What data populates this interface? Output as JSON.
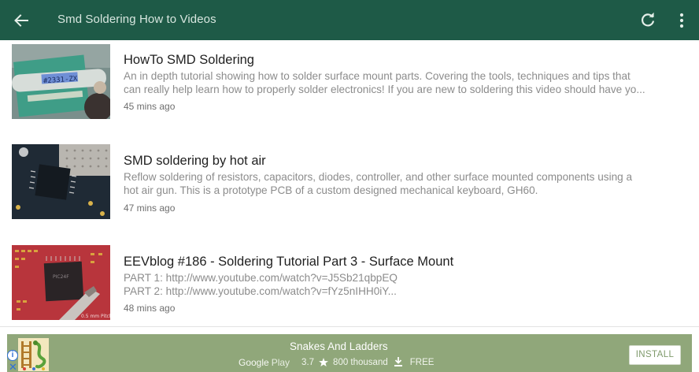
{
  "appbar": {
    "title": "Smd Soldering How to Videos",
    "back_icon": "arrow-left-icon",
    "refresh_icon": "refresh-icon",
    "more_icon": "more-vert-icon"
  },
  "videos": [
    {
      "title": "HowTo SMD Soldering",
      "description_lines": [
        "An in depth tutorial showing how to solder surface mount parts. Covering the tools, techniques and tips that",
        "can really help learn how to properly solder electronics! If you are new to soldering this video should have yo..."
      ],
      "time": "45 mins ago"
    },
    {
      "title": "SMD soldering by hot air",
      "description_lines": [
        "Reflow soldering of resistors, capacitors, diodes, controller, and other surface mounted components using a",
        "hot air gun. This is a prototype PCB of a custom designed mechanical keyboard, GH60."
      ],
      "time": "47 mins ago"
    },
    {
      "title": "EEVblog #186 - Soldering Tutorial Part 3 - Surface Mount",
      "description_lines": [
        "PART 1: http://www.youtube.com/watch?v=J5Sb21qbpEQ",
        "PART 2: http://www.youtube.com/watch?v=fYz5nIHH0iY..."
      ],
      "time": "48 mins ago"
    }
  ],
  "ad": {
    "app_name": "Snakes And Ladders",
    "store_google": "Google",
    "store_play": "Play",
    "rating": "3.7",
    "installs": "800 thousand",
    "price": "FREE",
    "install_label": "INSTALL",
    "info_glyph": "i",
    "close_glyph": "✕",
    "background_color": "#90a77a"
  },
  "colors": {
    "appbar": "#1e5a47",
    "title_text": "#d7e6df"
  }
}
